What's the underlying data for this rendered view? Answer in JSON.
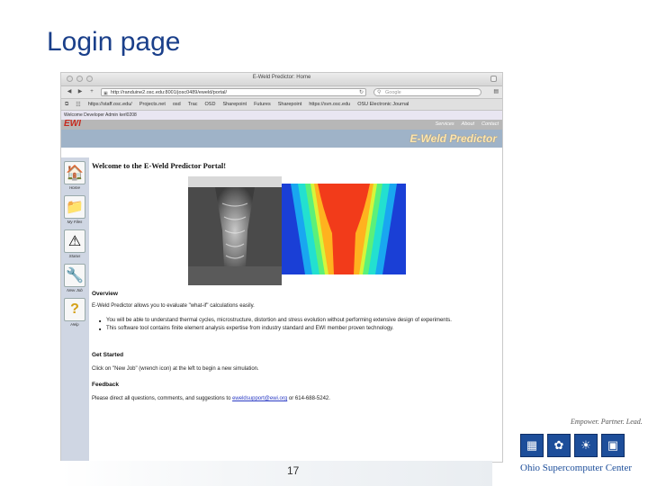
{
  "slide": {
    "title": "Login page",
    "page_number": "17"
  },
  "browser": {
    "window_title": "E-Weld Predictor: Home",
    "url": "http://randuine2.osc.edu:8001/josc0489/eweld/portal/",
    "search_placeholder": "Google",
    "bookmarks": [
      "https://staff.osc.edu/",
      "Projects.net",
      "osd",
      "Trac",
      "OSD",
      "Sharepoint",
      "Futures",
      "Sharepoint",
      "https://svn.osc.edu",
      "OSU Electronic Journal"
    ]
  },
  "site": {
    "welcome_text": "Welcome Developer Admin kerl0208",
    "logo": "EWI",
    "nav": [
      "Services",
      "About",
      "Contact"
    ],
    "product_name": "E-Weld Predictor",
    "sidebar": [
      {
        "label": "Home",
        "icon": "home-icon"
      },
      {
        "label": "My Files",
        "icon": "folder-icon"
      },
      {
        "label": "Status",
        "icon": "warning-icon"
      },
      {
        "label": "New Job",
        "icon": "wrench-icon"
      },
      {
        "label": "Help",
        "icon": "help-icon"
      }
    ],
    "heading": "Welcome to the E-Weld Predictor Portal!",
    "overview_heading": "Overview",
    "overview_text": "E-Weld Predictor allows you to evaluate \"what-if\" calculations easily.",
    "bullets": [
      "You will be able to understand thermal cycles, microstructure, distortion and stress evolution without performing extensive design of experiments.",
      "This software tool contains finite element analysis expertise from industry standard and EWI member proven technology."
    ],
    "get_started_heading": "Get Started",
    "get_started_text": "Click on \"New Job\" (wrench icon) at the left to begin a new simulation.",
    "feedback_heading": "Feedback",
    "feedback_prefix": "Please direct all questions, comments, and suggestions to",
    "feedback_email": "eweldsupport@ewi.org",
    "feedback_or": "or",
    "feedback_phone": "614-688-5242."
  },
  "osc": {
    "tagline": "Empower. Partner. Lead.",
    "name": "Ohio Supercomputer Center"
  },
  "colors": {
    "title_blue": "#1a3f8a",
    "ewi_red": "#c62b1f",
    "banner": "#9fb3c8",
    "osc_blue": "#1d4e9a"
  }
}
